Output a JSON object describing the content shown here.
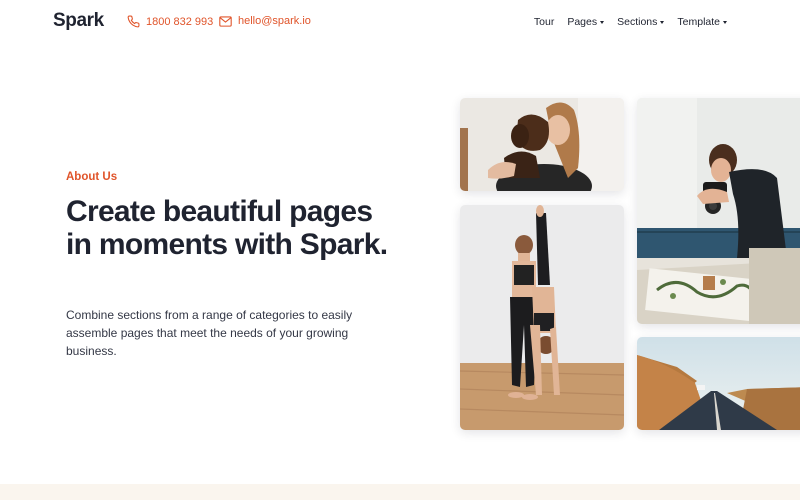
{
  "header": {
    "logo": "Spark",
    "phone": "1800 832 993",
    "email": "hello@spark.io",
    "nav": [
      {
        "label": "Tour",
        "has_dropdown": false
      },
      {
        "label": "Pages",
        "has_dropdown": true
      },
      {
        "label": "Sections",
        "has_dropdown": true
      },
      {
        "label": "Template",
        "has_dropdown": true
      }
    ]
  },
  "hero": {
    "eyebrow": "About Us",
    "headline": "Create beautiful pages in moments with Spark.",
    "description": "Combine sections from a range of categories to easily assemble pages that meet the needs of your growing business."
  },
  "photos": [
    {
      "subject": "woman-hugging-dog"
    },
    {
      "subject": "two-women-doing-yoga"
    },
    {
      "subject": "person-photographing-plants"
    },
    {
      "subject": "road-through-landscape"
    }
  ],
  "colors": {
    "accent": "#e0542a",
    "text": "#1f2330",
    "footer_band": "#faf5ee"
  }
}
